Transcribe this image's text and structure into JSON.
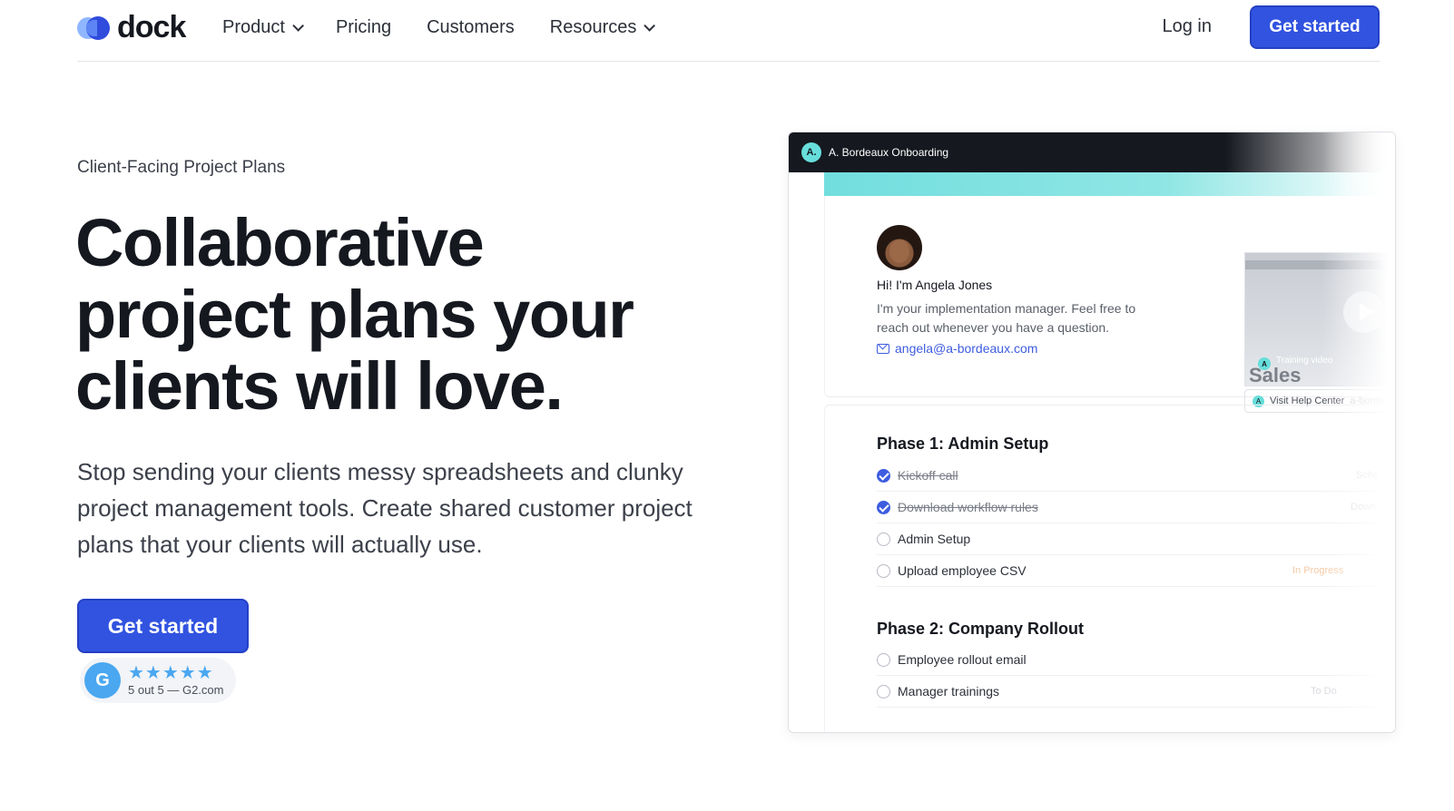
{
  "nav": {
    "logo_text": "dock",
    "links": [
      {
        "label": "Product",
        "dropdown": true
      },
      {
        "label": "Pricing",
        "dropdown": false
      },
      {
        "label": "Customers",
        "dropdown": false
      },
      {
        "label": "Resources",
        "dropdown": true
      }
    ],
    "login_label": "Log in",
    "cta_label": "Get started"
  },
  "hero": {
    "eyebrow": "Client-Facing Project Plans",
    "headline": "Collaborative project plans your clients will love.",
    "subheadline": "Stop sending your clients messy spreadsheets and clunky project management tools. Create shared customer project plans that your clients will actually use.",
    "cta_label": "Get started",
    "rating": {
      "badge": "G",
      "stars": "★★★★★",
      "text": "5 out 5 — G2.com"
    }
  },
  "mockup": {
    "workspace_avatar": "A.",
    "workspace_title": "A. Bordeaux Onboarding",
    "intro": {
      "greeting": "Hi! I'm Angela Jones",
      "message": "I'm your implementation manager. Feel free to reach out whenever you have a question.",
      "email": "angela@a-bordeaux.com"
    },
    "video": {
      "caption": "Training video",
      "overlay_text": "Sales",
      "avatar": "A"
    },
    "help_link": {
      "avatar": "A",
      "label": "Visit Help Center",
      "url": "a-bordeaux.com"
    },
    "phases": [
      {
        "title": "Phase 1: Admin Setup",
        "tasks": [
          {
            "label": "Kickoff call",
            "done": true,
            "status": "Sche"
          },
          {
            "label": "Download workflow rules",
            "done": true,
            "status": "Down"
          },
          {
            "label": "Admin Setup",
            "done": false,
            "status": ""
          },
          {
            "label": "Upload employee CSV",
            "done": false,
            "status": "In Progress"
          }
        ]
      },
      {
        "title": "Phase 2: Company Rollout",
        "tasks": [
          {
            "label": "Employee rollout email",
            "done": false,
            "status": ""
          },
          {
            "label": "Manager trainings",
            "done": false,
            "status": "To Do"
          }
        ]
      }
    ]
  },
  "colors": {
    "accent": "#3153e0",
    "teal": "#72dede",
    "dark": "#15181f",
    "star": "#4aa7f0"
  }
}
